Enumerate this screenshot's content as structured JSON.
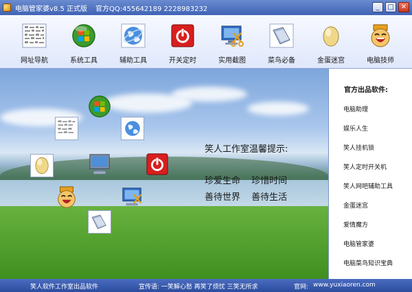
{
  "window": {
    "title": "电脑管家婆v8.5 正式版",
    "qq": "官方QQ:455642189  2228983232",
    "controls": {
      "minimize": "_",
      "maximize": "□",
      "close": "✕"
    }
  },
  "toolbar": {
    "items": [
      {
        "label": "网址导航",
        "icon": "web-nav-icon"
      },
      {
        "label": "系统工具",
        "icon": "windows-logo-icon"
      },
      {
        "label": "辅助工具",
        "icon": "globe-icon"
      },
      {
        "label": "开关定时",
        "icon": "power-icon"
      },
      {
        "label": "实用截图",
        "icon": "screenshot-icon"
      },
      {
        "label": "菜鸟必备",
        "icon": "folder-icon"
      },
      {
        "label": "金蛋迷宫",
        "icon": "golden-egg-icon"
      },
      {
        "label": "电脑技师",
        "icon": "laughing-face-icon"
      }
    ]
  },
  "main": {
    "tip_title": "笑人工作室温馨提示:",
    "tip_line1": "珍爱生命 珍惜时间",
    "tip_line2": "善待世界 善待生活"
  },
  "side": {
    "title": "官方出品软件:",
    "items": [
      "电脑助理",
      "娱乐人生",
      "笑人挂机锁",
      "笑人定时开关机",
      "笑人网吧辅助工具",
      "金蛋迷宫",
      "爱情魔方",
      "电脑管家婆",
      "电脑菜鸟知识宝典"
    ]
  },
  "status": {
    "left": "笑人软件工作室出品软件",
    "slogan": "宣传语:  一笑解心愁  再笑了烦忧  三笑无所求",
    "site_label": "官网:",
    "site_url": "www.yuxiaoren.com"
  },
  "colors": {
    "titlebar": "#3f63b5",
    "statusbar": "#2c4d9e",
    "power_red": "#d81e1e"
  }
}
